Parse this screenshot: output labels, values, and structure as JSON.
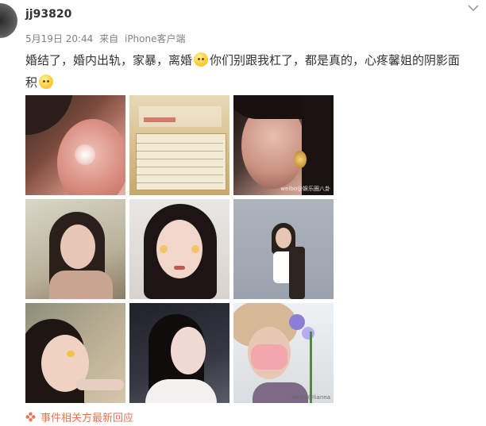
{
  "post": {
    "username": "jj93820",
    "date": "5月19日 20:44",
    "from": "来自",
    "client": "iPhone客户端",
    "text_part1": "婚结了，婚内出轨，家暴，离婚",
    "text_part2": "你们别跟我杠了，都是真的，心疼馨姐的阴影面积",
    "emoji_name": "face-emoji"
  },
  "photos": [
    {
      "name": "close-up-face",
      "watermark": ""
    },
    {
      "name": "document",
      "watermark": ""
    },
    {
      "name": "earring",
      "watermark": "weibo@娱乐圈八卦"
    },
    {
      "name": "portrait-hands",
      "watermark": ""
    },
    {
      "name": "portrait-front",
      "watermark": ""
    },
    {
      "name": "full-body",
      "watermark": ""
    },
    {
      "name": "portrait-light",
      "watermark": ""
    },
    {
      "name": "portrait-profile",
      "watermark": ""
    },
    {
      "name": "mask-flowers",
      "watermark": "weibo@lianna"
    }
  ],
  "response_link": "事件相关方最新回应",
  "colors": {
    "accent": "#eb7350",
    "meta_gray": "#808080",
    "text": "#333333"
  }
}
